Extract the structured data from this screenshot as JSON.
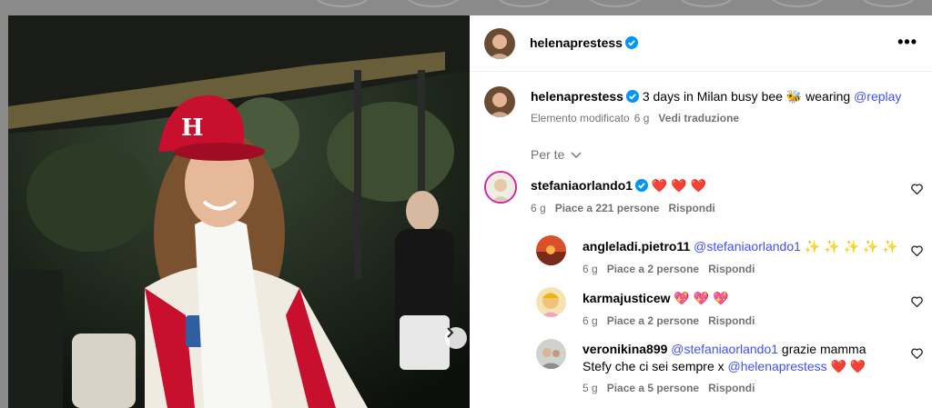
{
  "post": {
    "author": "helenaprestess",
    "verified": true
  },
  "caption": {
    "author": "helenaprestess",
    "text": "3 days in Milan busy bee",
    "emoji": "🐝",
    "text_after": "wearing",
    "mention": "@replay",
    "edited": "Elemento modificato",
    "time": "6 g",
    "translate": "Vedi traduzione"
  },
  "filter_label": "Per te",
  "comments": [
    {
      "user": "stefaniaorlando1",
      "verified": true,
      "text": "",
      "emojis": "❤️ ❤️ ❤️",
      "time": "6 g",
      "likes": "Piace a 221 persone",
      "reply": "Rispondi"
    }
  ],
  "replies": [
    {
      "user": "angleladi.pietro11",
      "mention": "@stefaniaorlando1",
      "emojis": "✨ ✨ ✨ ✨ ✨",
      "time": "6 g",
      "likes": "Piace a 2 persone",
      "reply": "Rispondi"
    },
    {
      "user": "karmajusticew",
      "emojis": "💖 💖 💖",
      "time": "6 g",
      "likes": "Piace a 2 persone",
      "reply": "Rispondi"
    },
    {
      "user": "veronikina899",
      "mention": "@stefaniaorlando1",
      "text1": "grazie mamma",
      "text2": "Stefy che ci sei sempre x",
      "mention2": "@helenaprestess",
      "emojis": "❤️ ❤️",
      "time": "5 g",
      "likes": "Piace a 5 persone",
      "reply": "Rispondi"
    }
  ],
  "colors": {
    "verified": "#0095f6",
    "mention": "#4150f7",
    "cap": "#c8102e"
  },
  "icons": {
    "more": "more-options-icon",
    "heart": "heart-outline-icon",
    "next": "chevron-right-icon",
    "verified": "verified-badge-icon",
    "chevron": "chevron-down-icon"
  }
}
